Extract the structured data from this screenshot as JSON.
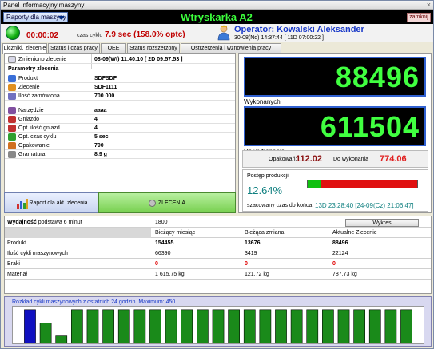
{
  "window": {
    "title": "Panel informacyjny maszyny",
    "close_glyph": "×"
  },
  "header": {
    "reports_menu": "Raporty dla maszyny",
    "machine_title": "Wtryskarka A2",
    "close_button": "zamknij"
  },
  "status": {
    "elapsed": "00:00:02",
    "cycle_label": "czas cyklu",
    "cycle_value": "7.9 sec",
    "cycle_pct": "(158.0% optc)",
    "operator": "Operator:  Kowalski Aleksander",
    "operator_date": "30-08(Nd) 14:37:44  [ 11D 07:00:22 ]"
  },
  "tabs": [
    "Liczniki, zlecenie",
    "Status i czas pracy",
    "OEE",
    "Status rozszerzony",
    "Ostrzerzenia i wznowienia pracy"
  ],
  "order": {
    "changed_label": "Zmieniono zlecenie",
    "changed_value": "08-09(Wt) 11:40:10  [ 2D 09:57:53 ]",
    "params_heading": "Parametry zlecenia",
    "rows_a": [
      {
        "label": "Produkt",
        "value": "SDFSDF",
        "icon": "product-icon",
        "color": "#3a6fd8"
      },
      {
        "label": "Zlecenie",
        "value": "SDF1111",
        "icon": "order-icon",
        "color": "#e09020"
      },
      {
        "label": "Ilość zamówiona",
        "value": " 700 000",
        "icon": "quantity-icon",
        "color": "#7070c0"
      }
    ],
    "rows_b": [
      {
        "label": "Narzędzie",
        "value": "aaaa",
        "icon": "tool-icon",
        "color": "#8050a0"
      },
      {
        "label": "Gniazdo",
        "value": "4",
        "icon": "socket-icon",
        "color": "#c03030"
      },
      {
        "label": "Opt. ilość gniazd",
        "value": "4",
        "icon": "socket-count-icon",
        "color": "#c03030"
      },
      {
        "label": "Opt. czas cyklu",
        "value": "5 sec.",
        "icon": "cycle-time-icon",
        "color": "#30a030"
      },
      {
        "label": "Opakowanie",
        "value": "790",
        "icon": "package-icon",
        "color": "#d07020"
      },
      {
        "label": "Gramatura",
        "value": "8.9 g",
        "icon": "weight-icon",
        "color": "#888888"
      }
    ],
    "report_button": "Raport dla akt. zlecenia",
    "orders_button": "ZLECENIA"
  },
  "counters": {
    "produced": "88496",
    "produced_label": "Wykonanych",
    "remaining": "611504",
    "remaining_label": "Do wyfronania"
  },
  "packaging": {
    "packs_label": "Opakowań:",
    "packs_value": "112.02",
    "todo_label": "Do wykonania",
    "todo_value": "774.06"
  },
  "progress": {
    "label": "Postęp produkcji",
    "percent": "12.64%",
    "fraction": 0.1264,
    "eta_label": "szacowany czas do końca",
    "eta_value": "13D 23:28:40 [24-09(Cz) 21:06:47]",
    "color_done": "#10c010",
    "color_left": "#e01010"
  },
  "efficiency": {
    "title_bold": "Wydajność",
    "title_rest": " podstawa 6 minut",
    "value": "1800",
    "chart_button": "Wykres",
    "columns": [
      "Bieżący miesiąc",
      "Bieżąca zmiana",
      "Aktualne Zlecenie"
    ],
    "rows": [
      {
        "label": "Produkt",
        "cells": [
          "154455",
          "13676",
          "88496"
        ],
        "bold": true,
        "red": false
      },
      {
        "label": "Ilość cykli maszynowych",
        "cells": [
          "66390",
          "3419",
          "22124"
        ],
        "bold": false,
        "red": false
      },
      {
        "label": "Braki",
        "cells": [
          "0",
          "0",
          "0"
        ],
        "bold": true,
        "red": true
      },
      {
        "label": "Materiał",
        "cells": [
          "1 615.75 kg",
          "121.72 kg",
          "787.73 kg"
        ],
        "bold": false,
        "red": false
      }
    ]
  },
  "chart_data": {
    "type": "bar",
    "title": "Rozkład cykli maszynowych z ostatnich 24 godzin. Maximum: 450",
    "ylim": [
      0,
      450
    ],
    "values": [
      450,
      270,
      100,
      450,
      450,
      450,
      450,
      450,
      450,
      450,
      450,
      450,
      450,
      450,
      450,
      450,
      450,
      450,
      450,
      450,
      450,
      450,
      450,
      450,
      450
    ],
    "colors": [
      "#1010c0",
      "#1a8a1a",
      "#1a8a1a",
      "#1a8a1a",
      "#1a8a1a",
      "#1a8a1a",
      "#1a8a1a",
      "#1a8a1a",
      "#1a8a1a",
      "#1a8a1a",
      "#1a8a1a",
      "#1a8a1a",
      "#1a8a1a",
      "#1a8a1a",
      "#1a8a1a",
      "#1a8a1a",
      "#1a8a1a",
      "#1a8a1a",
      "#1a8a1a",
      "#1a8a1a",
      "#1a8a1a",
      "#1a8a1a",
      "#1a8a1a",
      "#1a8a1a",
      "#1a8a1a"
    ]
  }
}
